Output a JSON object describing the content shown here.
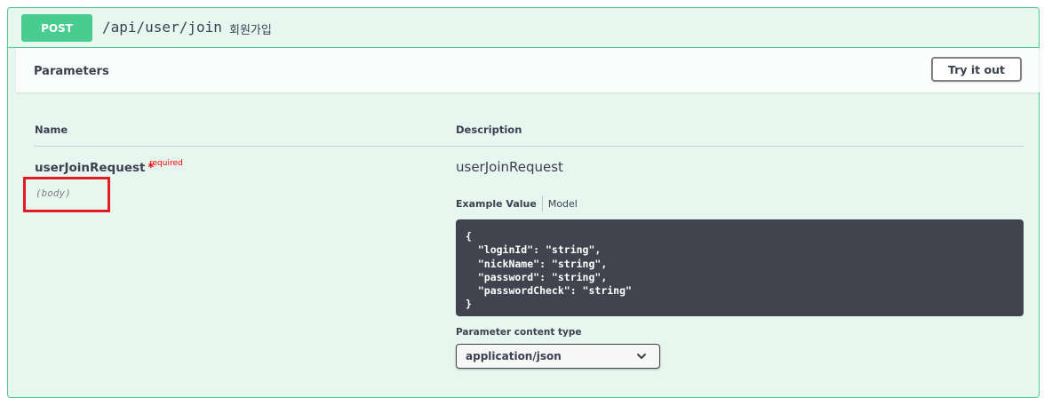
{
  "operation": {
    "method": "POST",
    "path": "/api/user/join",
    "summary": "회원가입"
  },
  "parameters_section": {
    "title": "Parameters",
    "try_button": "Try it out"
  },
  "table": {
    "name_header": "Name",
    "description_header": "Description"
  },
  "parameter": {
    "name": "userJoinRequest",
    "required_star": "*",
    "required_label": "required",
    "location": "(body)",
    "description": "userJoinRequest"
  },
  "example": {
    "tab_example": "Example Value",
    "tab_model": "Model",
    "code": "{\n  \"loginId\": \"string\",\n  \"nickName\": \"string\",\n  \"password\": \"string\",\n  \"passwordCheck\": \"string\"\n}"
  },
  "content_type": {
    "label": "Parameter content type",
    "selected": "application/json"
  },
  "colors": {
    "post_green": "#49cc90",
    "highlight_red": "#e21b24",
    "code_bg": "#41444e"
  }
}
